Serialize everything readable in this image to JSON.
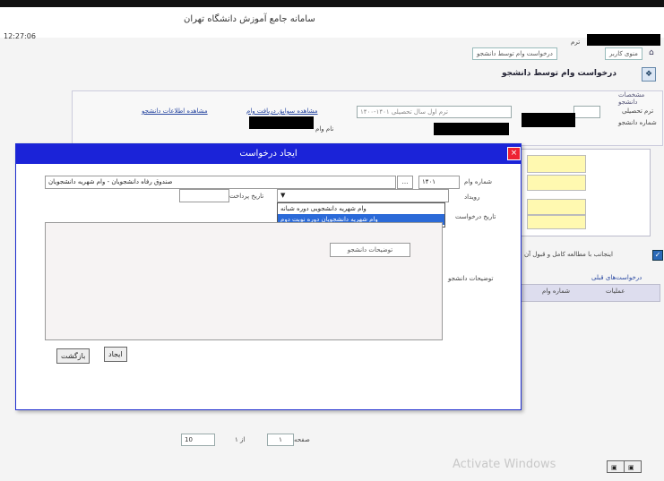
{
  "header": {
    "title": "سامانه جامع آموزش   دانشگاه تهران",
    "clock": "12:27:06"
  },
  "breadcrumb": [
    "منوی کاربر",
    "درخواست وام توسط دانشجو"
  ],
  "breadcrumb_field": "ترم",
  "page_title": "درخواست وام توسط دانشجو",
  "section": {
    "label": "مشخصات دانشجو",
    "term_label": "ترم تحصیلی",
    "student_label": "شماره دانشجو",
    "term_value": "ترم اول سال تحصیلی ۱۴۰۱-۱۴۰۰",
    "view_loan_link": "مشاهده سوابق دریافت وام",
    "view_info_link": "مشاهده اطلاعات دانشجو",
    "loan_label": "نام وام"
  },
  "dialog": {
    "title": "ایجاد درخواست",
    "close_glyph": "×",
    "loan_number_label": "شماره وام",
    "loan_number_value": "۱۴۰۱",
    "loan_desc_value": "صندوق رفاه دانشجویان - وام شهریه دانشجویان",
    "event_label": "رویداد",
    "request_date_label": "تاریخ درخواست",
    "date_label": "تاریخ پرداخت",
    "dropdown_options": [
      "وام شهریه دانشجویی دوره شبانه",
      "وام شهریه دانشجویان دوره نوبت دوم"
    ],
    "student_desc_label": "توضیحات دانشجو",
    "inner_button": "توضیحات دانشجو",
    "ok_button": "ایجاد",
    "back_button": "بازگشت"
  },
  "right_panel": {
    "check_label": "اینجانب با مطالعه کامل و قبول آن"
  },
  "table": {
    "title": "درخواست‌های قبلی",
    "col1": "شماره وام",
    "col2": "عملیات"
  },
  "pager": {
    "page_label": "صفحه",
    "page_value": "۱",
    "of_label": "از ۱",
    "page_size": "10"
  },
  "watermark": "Activate Windows"
}
